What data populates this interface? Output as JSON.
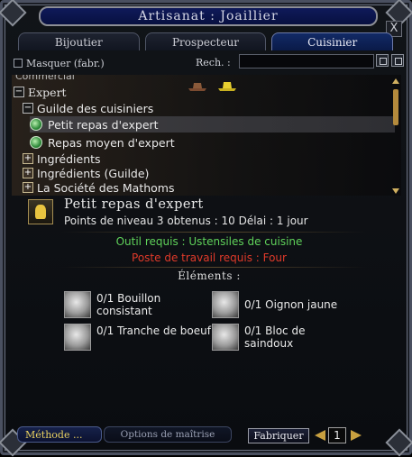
{
  "window": {
    "title": "Artisanat : Joaillier",
    "close_glyph": "X"
  },
  "tabs": [
    {
      "label": "Bijoutier",
      "active": false
    },
    {
      "label": "Prospecteur",
      "active": false
    },
    {
      "label": "Cuisinier",
      "active": true
    }
  ],
  "filters": {
    "hide_label": "Masquer (fabr.)",
    "search_label": "Rech. :",
    "search_value": ""
  },
  "tree": {
    "cut_label": "Commercial",
    "category": "Expert",
    "guild": "Guilde des cuisiniers",
    "recipes": [
      "Petit repas d'expert",
      "Repas moyen d'expert"
    ],
    "folders": [
      "Ingrédients",
      "Ingrédients (Guilde)",
      "La Société des Mathoms"
    ]
  },
  "recipe": {
    "title": "Petit repas d'expert",
    "info": "Points de niveau 3 obtenus : 10 Délai : 1 jour",
    "tool_required": "Outil requis : Ustensiles de cuisine",
    "station_required": "Poste de travail requis : Four",
    "elements_label": "Éléments :",
    "ingredients": [
      {
        "text": "0/1 Bouillon consistant",
        "icon": "broth-bowl-icon"
      },
      {
        "text": "0/1 Oignon jaune",
        "icon": "onion-icon"
      },
      {
        "text": "0/1 Tranche de boeuf",
        "icon": "beef-icon"
      },
      {
        "text": "0/1 Bloc de saindoux",
        "icon": "lard-icon"
      }
    ]
  },
  "footer": {
    "method_label": "Méthode ...",
    "options_label": "Options de maîtrise",
    "craft_label": "Fabriquer",
    "quantity": "1"
  },
  "colors": {
    "tool_required": "#5fd25a",
    "station_required": "#e03a2a",
    "accent_gold": "#c8a040"
  }
}
